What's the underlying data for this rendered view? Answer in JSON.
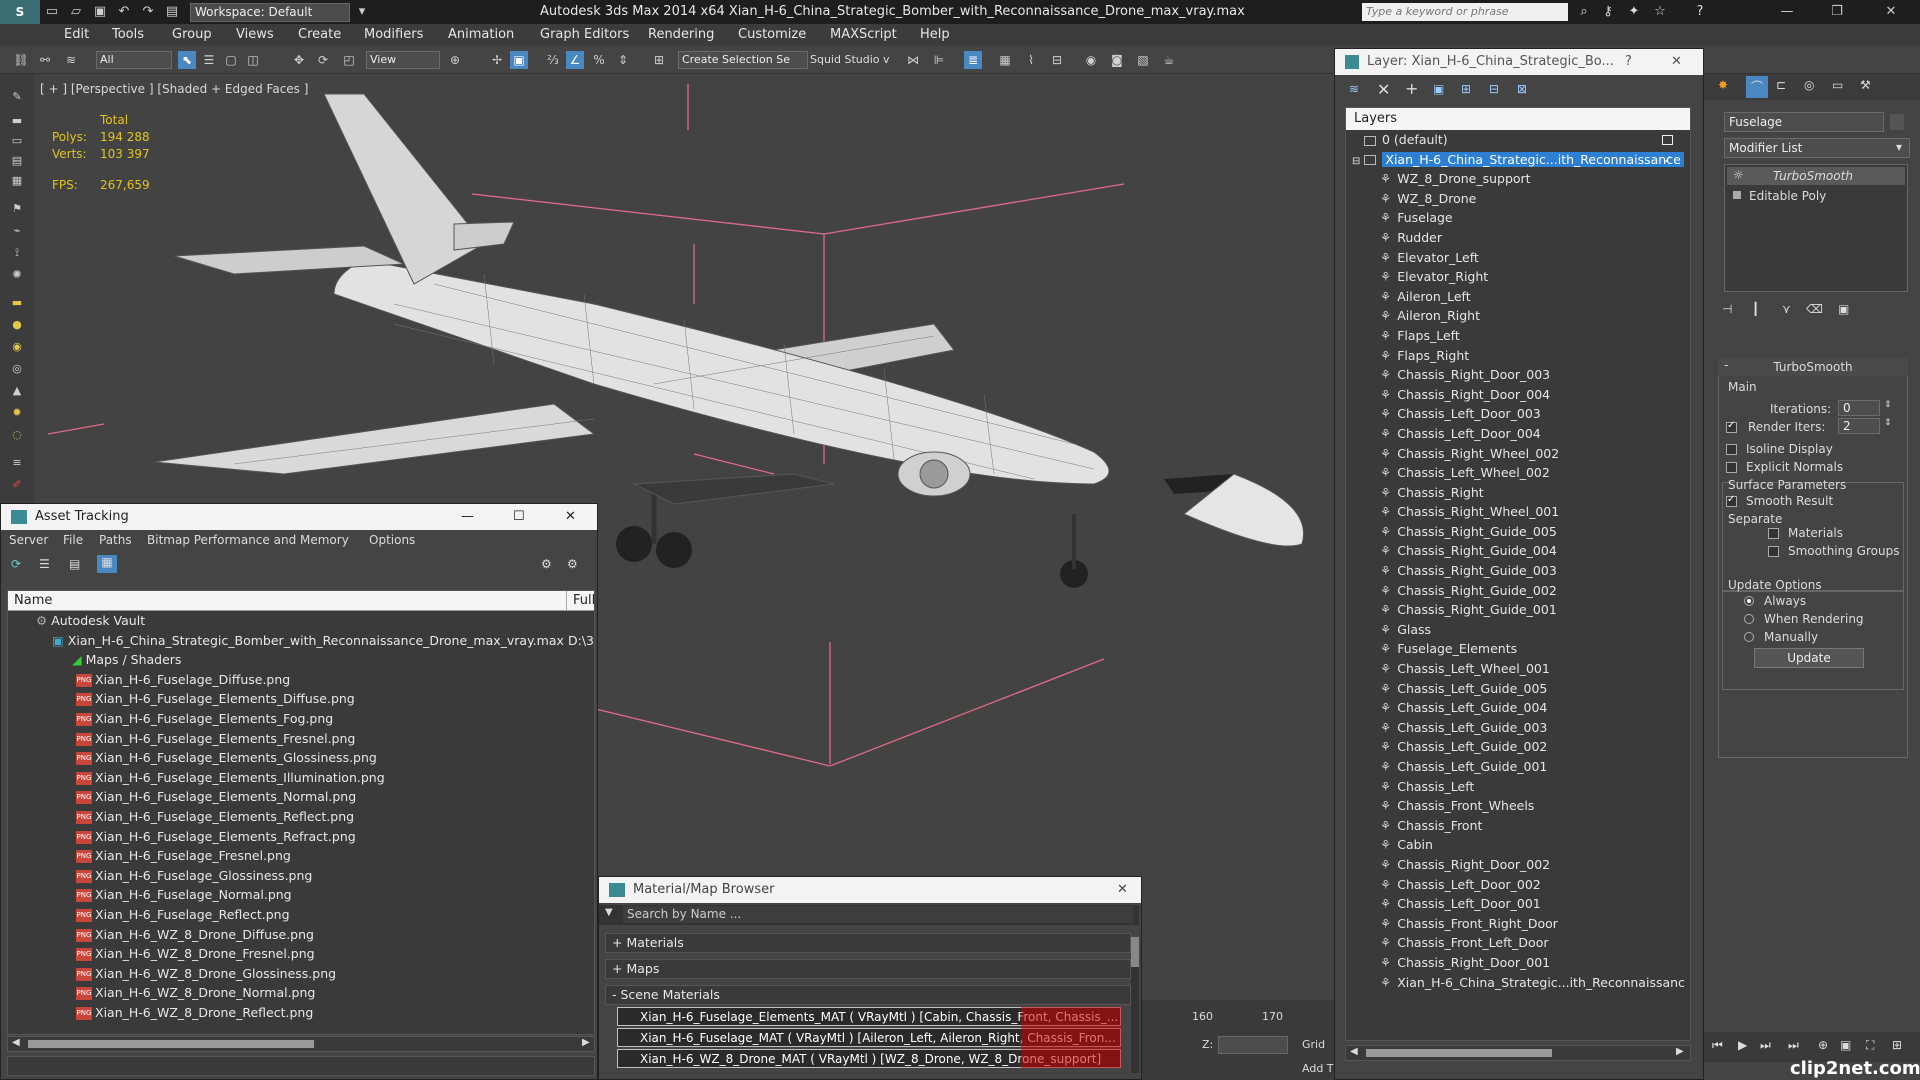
{
  "titlebar": {
    "workspace": "Workspace: Default",
    "app_title": "Autodesk 3ds Max  2014 x64      Xian_H-6_China_Strategic_Bomber_with_Reconnaissance_Drone_max_vray.max",
    "search_placeholder": "Type a keyword or phrase"
  },
  "menubar": [
    "Edit",
    "Tools",
    "Group",
    "Views",
    "Create",
    "Modifiers",
    "Animation",
    "Graph Editors",
    "Rendering",
    "Customize",
    "MAXScript",
    "Help"
  ],
  "toolbar": {
    "filter_combo": "All",
    "view_combo": "View",
    "selection_set": "Create Selection Se",
    "squid_studio": "Squid Studio v"
  },
  "viewport": {
    "label": "[ + ] [Perspective ] [Shaded + Edged Faces ]",
    "stats_total": "Total",
    "polys_label": "Polys:",
    "polys_value": "194 288",
    "verts_label": "Verts:",
    "verts_value": "103 397",
    "fps_label": "FPS:",
    "fps_value": "267,659"
  },
  "asset_tracking": {
    "title": "Asset Tracking",
    "menu": [
      "Server",
      "File",
      "Paths",
      "Bitmap Performance and Memory",
      "Options"
    ],
    "col_name": "Name",
    "col_full": "Full",
    "vault": "Autodesk Vault",
    "max_file": "Xian_H-6_China_Strategic_Bomber_with_Reconnaissance_Drone_max_vray.max",
    "max_file_path": "D:\\3",
    "maps_group": "Maps / Shaders",
    "files": [
      "Xian_H-6_Fuselage_Diffuse.png",
      "Xian_H-6_Fuselage_Elements_Diffuse.png",
      "Xian_H-6_Fuselage_Elements_Fog.png",
      "Xian_H-6_Fuselage_Elements_Fresnel.png",
      "Xian_H-6_Fuselage_Elements_Glossiness.png",
      "Xian_H-6_Fuselage_Elements_Illumination.png",
      "Xian_H-6_Fuselage_Elements_Normal.png",
      "Xian_H-6_Fuselage_Elements_Reflect.png",
      "Xian_H-6_Fuselage_Elements_Refract.png",
      "Xian_H-6_Fuselage_Fresnel.png",
      "Xian_H-6_Fuselage_Glossiness.png",
      "Xian_H-6_Fuselage_Normal.png",
      "Xian_H-6_Fuselage_Reflect.png",
      "Xian_H-6_WZ_8_Drone_Diffuse.png",
      "Xian_H-6_WZ_8_Drone_Fresnel.png",
      "Xian_H-6_WZ_8_Drone_Glossiness.png",
      "Xian_H-6_WZ_8_Drone_Normal.png",
      "Xian_H-6_WZ_8_Drone_Reflect.png"
    ]
  },
  "material_browser": {
    "title": "Material/Map Browser",
    "search_placeholder": "Search by Name ...",
    "sections": [
      "+ Materials",
      "+ Maps",
      "- Scene Materials"
    ],
    "materials": [
      "Xian_H-6_Fuselage_Elements_MAT  ( VRayMtl )  [Cabin, Chassis_Front, Chassis_...",
      "Xian_H-6_Fuselage_MAT  ( VRayMtl )  [Aileron_Left, Aileron_Right, Chassis_Fron...",
      "Xian_H-6_WZ_8_Drone_MAT  ( VRayMtl )  [WZ_8_Drone, WZ_8_Drone_support]"
    ]
  },
  "layer_window": {
    "title": "Layer: Xian_H-6_China_Strategic_Bo...",
    "help": "?",
    "header": "Layers",
    "default_layer": "0 (default)",
    "selected_layer": "Xian_H-6_China_Strategic...ith_Reconnaissance",
    "items": [
      "WZ_8_Drone_support",
      "WZ_8_Drone",
      "Fuselage",
      "Rudder",
      "Elevator_Left",
      "Elevator_Right",
      "Aileron_Left",
      "Aileron_Right",
      "Flaps_Left",
      "Flaps_Right",
      "Chassis_Right_Door_003",
      "Chassis_Right_Door_004",
      "Chassis_Left_Door_003",
      "Chassis_Left_Door_004",
      "Chassis_Right_Wheel_002",
      "Chassis_Left_Wheel_002",
      "Chassis_Right",
      "Chassis_Right_Wheel_001",
      "Chassis_Right_Guide_005",
      "Chassis_Right_Guide_004",
      "Chassis_Right_Guide_003",
      "Chassis_Right_Guide_002",
      "Chassis_Right_Guide_001",
      "Glass",
      "Fuselage_Elements",
      "Chassis_Left_Wheel_001",
      "Chassis_Left_Guide_005",
      "Chassis_Left_Guide_004",
      "Chassis_Left_Guide_003",
      "Chassis_Left_Guide_002",
      "Chassis_Left_Guide_001",
      "Chassis_Left",
      "Chassis_Front_Wheels",
      "Chassis_Front",
      "Cabin",
      "Chassis_Right_Door_002",
      "Chassis_Left_Door_002",
      "Chassis_Left_Door_001",
      "Chassis_Front_Right_Door",
      "Chassis_Front_Left_Door",
      "Chassis_Right_Door_001",
      "Xian_H-6_China_Strategic...ith_Reconnaissanc"
    ]
  },
  "command_panel": {
    "object_name": "Fuselage",
    "modifier_list": "Modifier List",
    "stack": [
      "TurboSmooth",
      "Editable Poly"
    ],
    "rollout_title": "TurboSmooth",
    "main_label": "Main",
    "iterations_label": "Iterations:",
    "iterations_value": "0",
    "render_iters_label": "Render Iters:",
    "render_iters_value": "2",
    "isoline": "Isoline Display",
    "explicit_normals": "Explicit Normals",
    "surface_params": "Surface Parameters",
    "smooth_result": "Smooth Result",
    "separate": "Separate",
    "materials": "Materials",
    "smoothing_groups": "Smoothing Groups",
    "update_options": "Update Options",
    "always": "Always",
    "when_rendering": "When Rendering",
    "manually": "Manually",
    "update_button": "Update"
  },
  "timeline": {
    "tick_160": "160",
    "tick_170": "170",
    "z_label": "Z:",
    "grid_label": "Grid",
    "add_label": "Add T"
  },
  "watermark": "clip2net.com",
  "colors": {
    "selection_blue": "#2d7fd3",
    "stats_yellow": "#e3c31f",
    "viewport_bg": "#434343",
    "bbox_pink": "#e06a8a"
  }
}
